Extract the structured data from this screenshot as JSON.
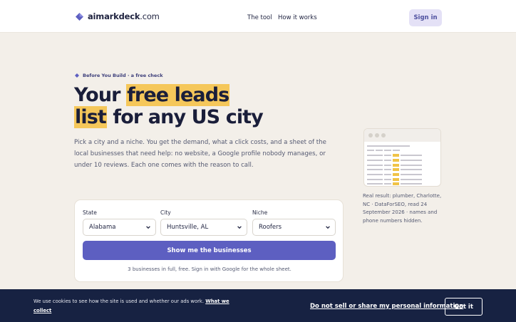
{
  "header": {
    "brand_bold": "aimarkdeck",
    "brand_rest": ".com",
    "nav": [
      "The tool",
      "How it works"
    ],
    "signin_label": "Sign in",
    "brand_color": "#5d5fc1"
  },
  "hero": {
    "eyebrow": "Before You Build · a free check",
    "headline_pre": "Your ",
    "headline_hl1": "free leads",
    "headline_hl2": "list",
    "headline_post": " for any US city",
    "lead": "Pick a city and a niche. You get the demand, what a click costs, and a sheet of the local businesses that need help: no website, a Google profile nobody manages, or under 10 reviews. Each one comes with the reason to call.",
    "highlight_color": "#f5c75a"
  },
  "form": {
    "state_label": "State",
    "state_value": "Alabama",
    "city_label": "City",
    "city_value": "Huntsville, AL",
    "niche_label": "Niche",
    "niche_value": "Roofers",
    "submit_label": "Show me the businesses",
    "note": "3 businesses in full, free. Sign in with Google for the whole sheet."
  },
  "preview": {
    "caption": "Real result: plumber, Charlotte, NC · DataForSEO, read 24 September 2026 · names and phone numbers hidden."
  },
  "cookie": {
    "text": "We use cookies to see how the site is used and whether our ads work.",
    "link": "What we collect",
    "dns_label": "Do not sell or share my personal information",
    "gotit_label": "Got it"
  }
}
